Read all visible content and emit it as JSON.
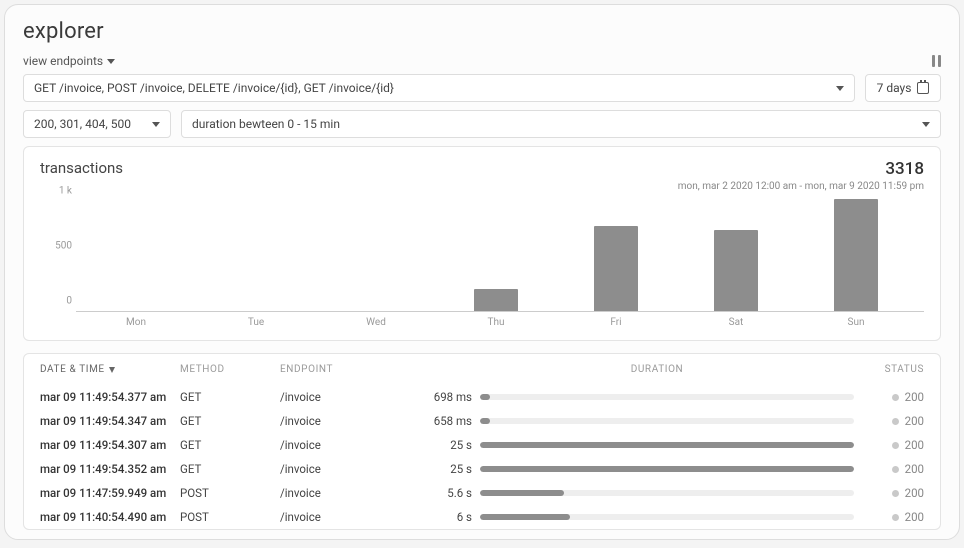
{
  "header": {
    "title": "explorer",
    "view_endpoints_label": "view endpoints",
    "pause_icon": "pause-icon"
  },
  "filters": {
    "endpoints": "GET /invoice, POST /invoice, DELETE /invoice/{id}, GET /invoice/{id}",
    "range": "7 days",
    "status_codes": "200, 301, 404, 500",
    "duration": "duration bewteen 0 - 15 min"
  },
  "chart_data": {
    "type": "bar",
    "title": "transactions",
    "total": "3318",
    "range_text": "mon, mar 2 2020 12:00 am - mon, mar 9 2020 11:59 pm",
    "categories": [
      "Mon",
      "Tue",
      "Wed",
      "Thu",
      "Fri",
      "Sat",
      "Sun"
    ],
    "values": [
      0,
      0,
      0,
      200,
      770,
      740,
      1020
    ],
    "ylabel": "",
    "xlabel": "",
    "ylim": [
      0,
      1000
    ],
    "y_ticks": [
      {
        "label": "1 k",
        "value": 1000
      },
      {
        "label": "500",
        "value": 500
      },
      {
        "label": "0",
        "value": 0
      }
    ]
  },
  "table": {
    "columns": {
      "datetime": "DATE & TIME",
      "method": "METHOD",
      "endpoint": "ENDPOINT",
      "duration": "DURATION",
      "status": "STATUS"
    },
    "sort": {
      "column": "datetime",
      "dir": "desc"
    },
    "rows": [
      {
        "datetime": "mar 09 11:49:54.377 am",
        "method": "GET",
        "endpoint": "/invoice",
        "duration_label": "698 ms",
        "duration_ms": 698,
        "status": "200"
      },
      {
        "datetime": "mar 09 11:49:54.347 am",
        "method": "GET",
        "endpoint": "/invoice",
        "duration_label": "658 ms",
        "duration_ms": 658,
        "status": "200"
      },
      {
        "datetime": "mar 09 11:49:54.307 am",
        "method": "GET",
        "endpoint": "/invoice",
        "duration_label": "25 s",
        "duration_ms": 25000,
        "status": "200"
      },
      {
        "datetime": "mar 09 11:49:54.352 am",
        "method": "GET",
        "endpoint": "/invoice",
        "duration_label": "25 s",
        "duration_ms": 25000,
        "status": "200"
      },
      {
        "datetime": "mar 09 11:47:59.949 am",
        "method": "POST",
        "endpoint": "/invoice",
        "duration_label": "5.6 s",
        "duration_ms": 5600,
        "status": "200"
      },
      {
        "datetime": "mar 09 11:40:54.490 am",
        "method": "POST",
        "endpoint": "/invoice",
        "duration_label": "6 s",
        "duration_ms": 6000,
        "status": "200"
      }
    ],
    "duration_max_ms": 25000
  }
}
